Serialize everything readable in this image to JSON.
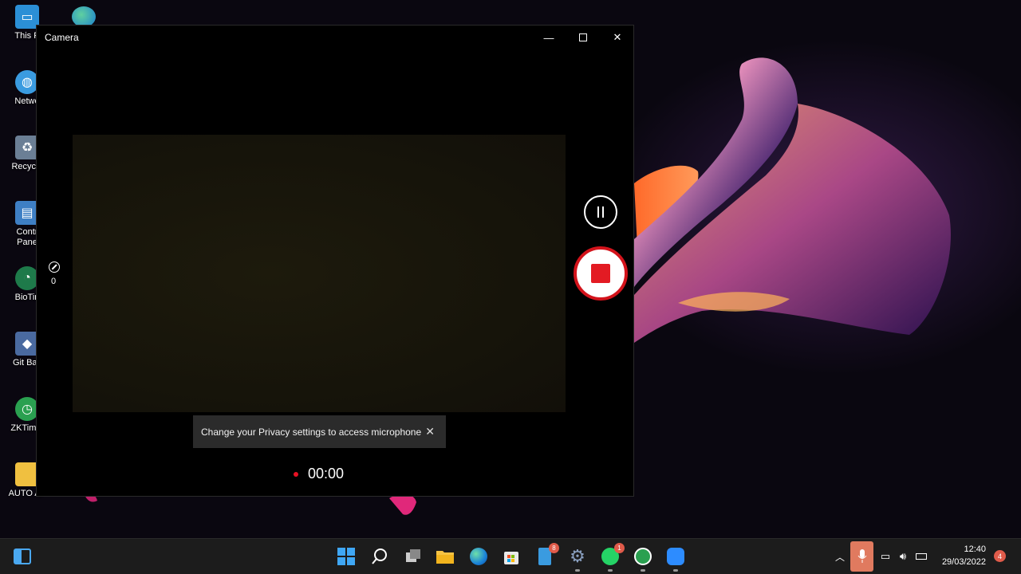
{
  "desktop": {
    "icons": [
      {
        "label": "This P",
        "icon": "this-pc-icon"
      },
      {
        "label": "Netwo",
        "icon": "network-icon"
      },
      {
        "label": "Recycle",
        "icon": "recycle-bin-icon"
      },
      {
        "label": "Contr\nPane",
        "icon": "control-panel-icon"
      },
      {
        "label": "BioTin",
        "icon": "biotime-icon"
      },
      {
        "label": "Git Bas",
        "icon": "git-bash-icon"
      },
      {
        "label": "ZKTime.",
        "icon": "zktime-icon"
      },
      {
        "label": "AUTO AF",
        "icon": "folder-icon"
      }
    ]
  },
  "camera": {
    "title": "Camera",
    "timer_count": "0",
    "toast_message": "Change your Privacy settings to access microphone",
    "recording_time": "00:00",
    "colors": {
      "record": "#e31b23",
      "background": "#000000"
    }
  },
  "taskbar": {
    "badges": {
      "files": "8",
      "whatsapp": "1"
    },
    "clock_time": "12:40",
    "clock_date": "29/03/2022",
    "notifications": "4"
  }
}
